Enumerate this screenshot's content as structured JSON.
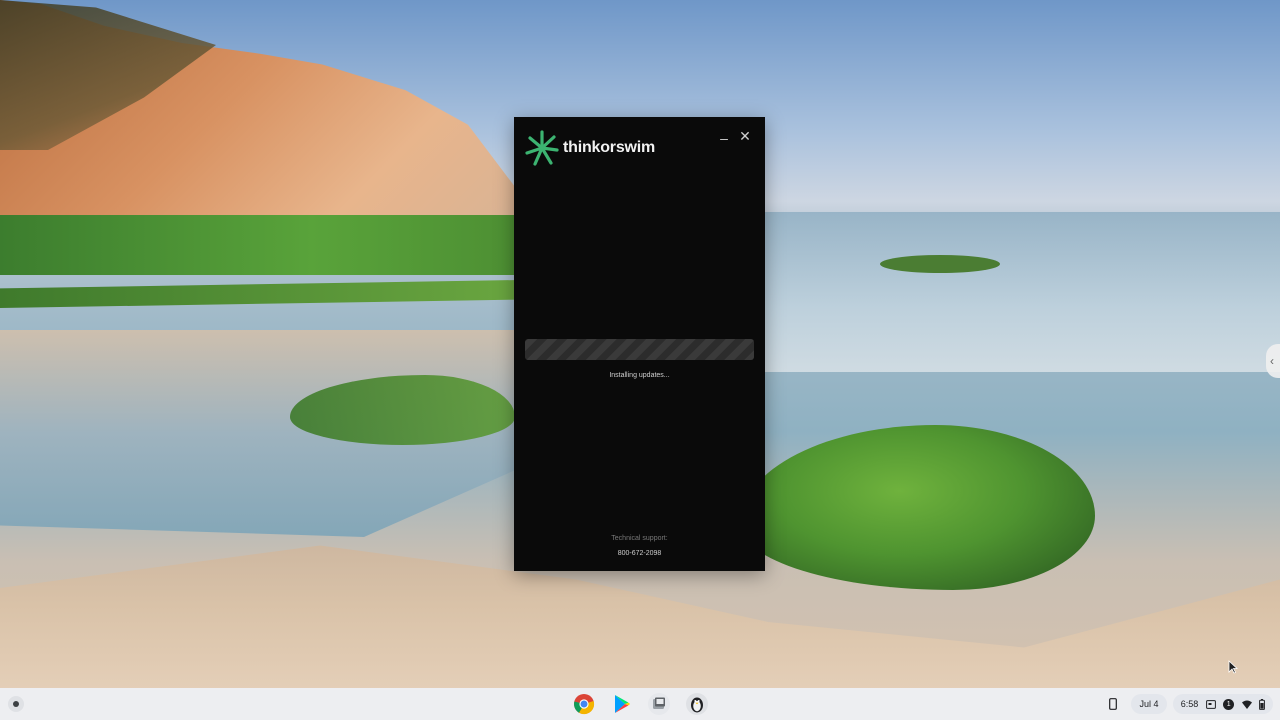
{
  "app": {
    "brand": "thinkorswim",
    "status_text": "Installing updates...",
    "support_label": "Technical support:",
    "support_phone": "800-672-2098",
    "accent_color": "#3cb371",
    "progress_style": "indeterminate"
  },
  "window_controls": {
    "minimize_glyph": "–",
    "close_glyph": "✕"
  },
  "shelf": {
    "launcher_icon": "launcher-icon",
    "apps": [
      {
        "name": "Chrome",
        "icon": "chrome-icon"
      },
      {
        "name": "Play Store",
        "icon": "play-store-icon"
      },
      {
        "name": "Files",
        "icon": "files-icon"
      },
      {
        "name": "Linux",
        "icon": "penguin-icon"
      }
    ],
    "date": "Jul 4",
    "time": "6:58",
    "notification_count": "1"
  },
  "colors": {
    "window_bg": "#0a0a0a",
    "shelf_bg": "#eef0f4"
  }
}
